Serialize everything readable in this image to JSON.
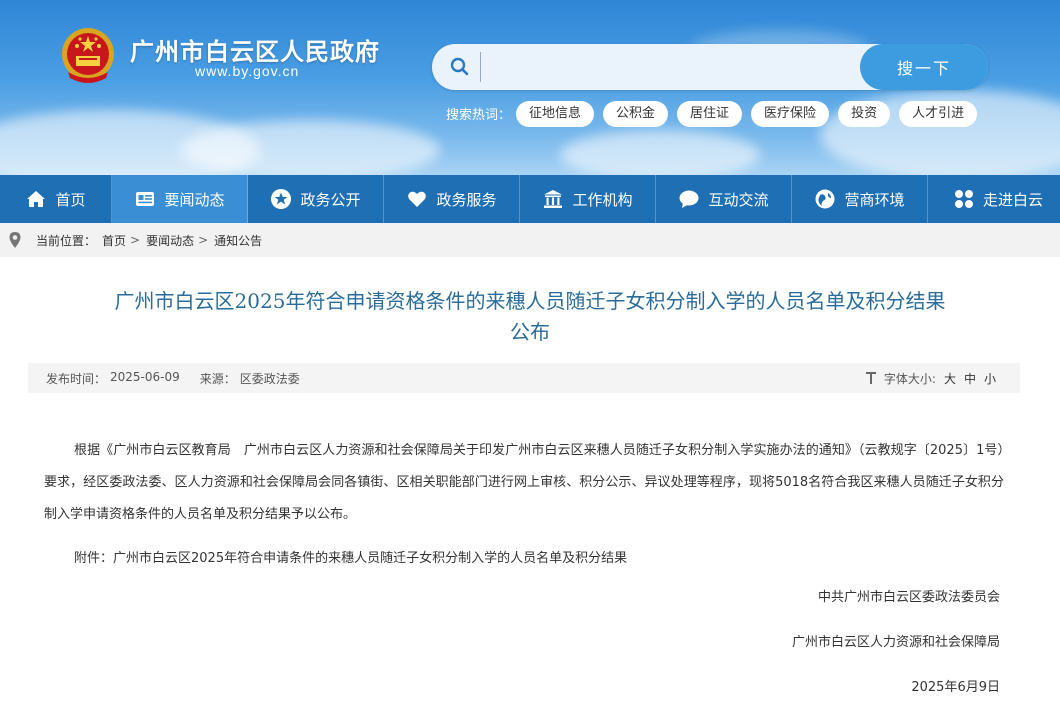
{
  "header": {
    "site_title": "广州市白云区人民政府",
    "site_url": "www.by.gov.cn",
    "search": {
      "placeholder": "",
      "button_label": "搜一下"
    },
    "hot_label": "搜索热词：",
    "hot_tags": [
      "征地信息",
      "公积金",
      "居住证",
      "医疗保险",
      "投资",
      "人才引进"
    ]
  },
  "nav": {
    "items": [
      {
        "label": "首页",
        "icon": "home-icon"
      },
      {
        "label": "要闻动态",
        "icon": "news-icon"
      },
      {
        "label": "政务公开",
        "icon": "star-icon"
      },
      {
        "label": "政务服务",
        "icon": "heart-icon"
      },
      {
        "label": "工作机构",
        "icon": "building-icon"
      },
      {
        "label": "互动交流",
        "icon": "chat-icon"
      },
      {
        "label": "营商环境",
        "icon": "globe-icon"
      },
      {
        "label": "走进白云",
        "icon": "grid-icon"
      }
    ],
    "active_index": 1
  },
  "breadcrumb": {
    "label": "当前位置：",
    "items": [
      "首页",
      "要闻动态",
      "通知公告"
    ],
    "separator": ">"
  },
  "article": {
    "title_line1": "广州市白云区2025年符合申请资格条件的来穗人员随迁子女积分制入学的人员名单及积分结果",
    "title_line2": "公布",
    "publish_label": "发布时间：",
    "publish_date": "2025-06-09",
    "source_label": "来源：",
    "source": "区委政法委",
    "font_size_label": "字体大小:",
    "font_sizes": [
      "大",
      "中",
      "小"
    ],
    "paragraph": "根据《广州市白云区教育局　广州市白云区人力资源和社会保障局关于印发广州市白云区来穗人员随迁子女积分制入学实施办法的通知》（云教规字〔2025〕1号）要求，经区委政法委、区人力资源和社会保障局会同各镇街、区相关职能部门进行网上审核、积分公示、异议处理等程序，现将5018名符合我区来穗人员随迁子女积分制入学申请资格条件的人员名单及积分结果予以公布。",
    "attachment": "附件：广州市白云区2025年符合申请条件的来穗人员随迁子女积分制入学的人员名单及积分结果",
    "signature1": "中共广州市白云区委政法委员会",
    "signature2": "广州市白云区人力资源和社会保障局",
    "signature_date": "2025年6月9日"
  },
  "colors": {
    "nav_bg": "#1f6fb5",
    "nav_active": "#3a8fd4",
    "title_color": "#2a6c9a",
    "search_button": "#3d9be0"
  }
}
